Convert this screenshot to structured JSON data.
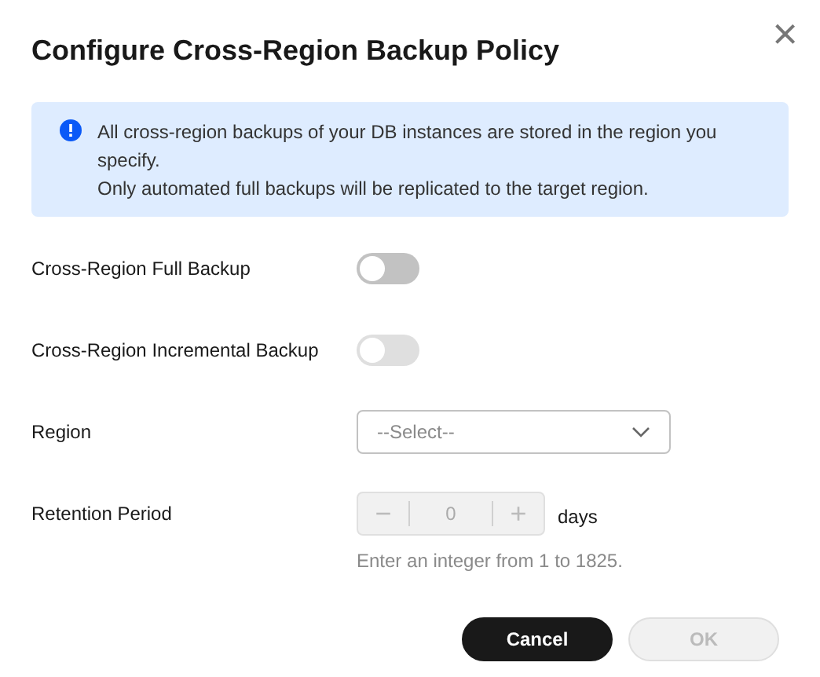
{
  "dialog": {
    "title": "Configure Cross-Region Backup Policy",
    "close": "×"
  },
  "notice": {
    "lines": [
      "All cross-region backups of your DB instances are stored in the region you specify.",
      "Only automated full backups will be replicated to the target region."
    ]
  },
  "fields": [
    {
      "kind": "switch",
      "label": "Cross-Region Full Backup",
      "on": false,
      "disabled": false
    },
    {
      "kind": "switch",
      "label": "Cross-Region Incremental Backup",
      "on": false,
      "disabled": true
    },
    {
      "kind": "select",
      "label": "Region",
      "placeholder": "--Select--"
    },
    {
      "kind": "stepper",
      "label": "Retention Period",
      "value": "0",
      "minus": "−",
      "plus": "+",
      "unit": "days",
      "disabled": true,
      "hint": "Enter an integer from 1 to 1825."
    }
  ],
  "buttons": [
    {
      "label": "Cancel",
      "kind": "primary",
      "disabled": false
    },
    {
      "label": "OK",
      "kind": "secondary",
      "disabled": true
    }
  ]
}
